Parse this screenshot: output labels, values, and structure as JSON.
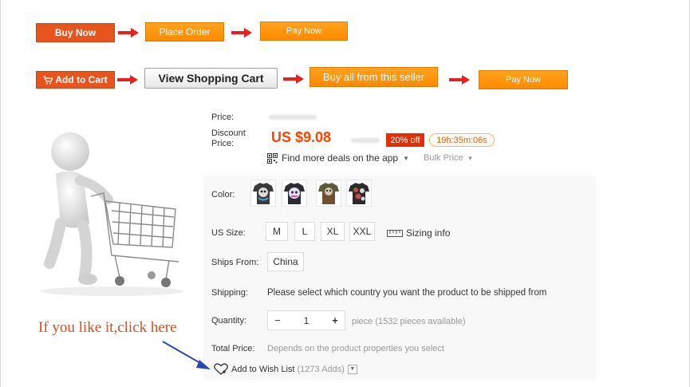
{
  "flow": {
    "row1": {
      "buy_now": "Buy Now",
      "place_order": "Place Order",
      "pay_now": "Pay Now"
    },
    "row2": {
      "add_to_cart": "Add to Cart",
      "view_cart": "View Shopping Cart",
      "buy_all": "Buy all from this seller",
      "pay_now": "Pay Now"
    }
  },
  "product": {
    "price_label": "Price:",
    "discount_label_1": "Discount",
    "discount_label_2": "Price:",
    "discount_price": "US $9.08",
    "discount_pct": "20% off",
    "timer": "19h:35m:06s",
    "deals_link": "Find more deals on the app",
    "bulk_price": "Bulk Price",
    "color_label": "Color:",
    "size_label": "US Size:",
    "sizes": [
      "M",
      "L",
      "XL",
      "XXL"
    ],
    "sizing_info": "Sizing info",
    "ships_from_label": "Ships From:",
    "ships_from_value": "China",
    "shipping_label": "Shipping:",
    "shipping_text": "Please select which country you want the product to be shipped from",
    "quantity_label": "Quantity:",
    "quantity_value": "1",
    "quantity_note": "piece (1532 pieces available)",
    "total_label": "Total Price:",
    "total_text": "Depends on the product properties you select",
    "wishlist": "Add to Wish List",
    "wishlist_count": "(1273 Adds)"
  },
  "hint_text": "If you like it,click here",
  "colors": {
    "accent": "#ff4400",
    "button_red": "#e8541e",
    "button_orange": "#ff9800",
    "hint": "#d84e1e"
  },
  "icons": [
    "cart-icon",
    "arrow-right-icon",
    "qr-code-icon",
    "ruler-icon",
    "heart-icon",
    "chevron-down-icon",
    "minus-icon",
    "plus-icon"
  ]
}
